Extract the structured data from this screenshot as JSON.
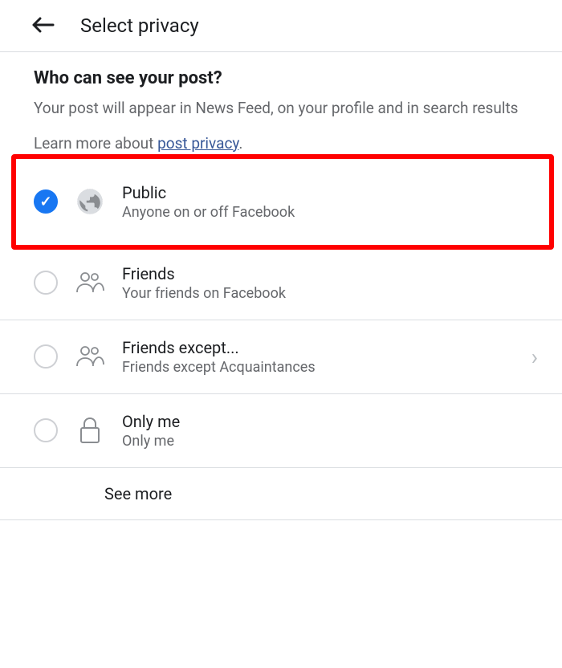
{
  "header": {
    "title": "Select privacy"
  },
  "subheader": {
    "question": "Who can see your post?",
    "description": "Your post will appear in News Feed, on your profile and in search results",
    "learn_more_prefix": "Learn more about ",
    "learn_more_link": "post privacy",
    "learn_more_suffix": "."
  },
  "options": {
    "public": {
      "title": "Public",
      "subtitle": "Anyone on or off Facebook",
      "selected": true
    },
    "friends": {
      "title": "Friends",
      "subtitle": "Your friends on Facebook"
    },
    "friends_except": {
      "title": "Friends except...",
      "subtitle": "Friends except Acquaintances"
    },
    "only_me": {
      "title": "Only me",
      "subtitle": "Only me"
    }
  },
  "see_more": {
    "label": "See more"
  }
}
